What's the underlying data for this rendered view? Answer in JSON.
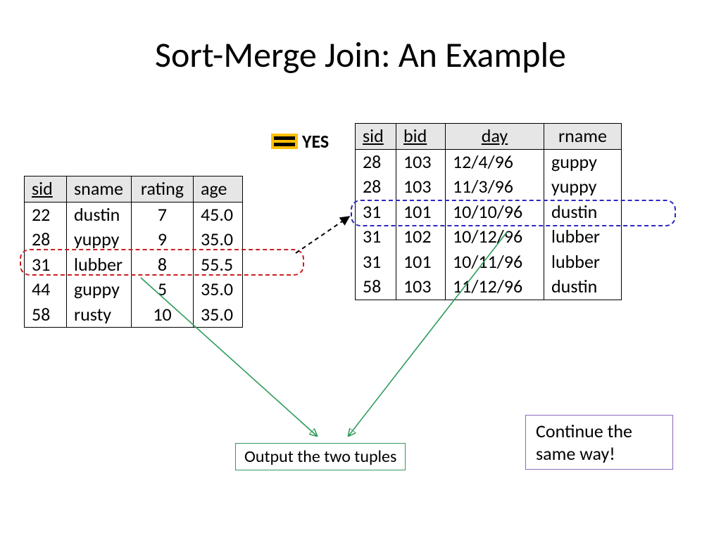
{
  "title": "Sort-Merge Join: An Example",
  "equals_label": "YES",
  "left": {
    "headers": {
      "sid": "sid",
      "sname": "sname",
      "rating": "rating",
      "age": "age"
    },
    "rows": [
      {
        "sid": "22",
        "sname": "dustin",
        "rating": "7",
        "age": "45.0"
      },
      {
        "sid": "28",
        "sname": "yuppy",
        "rating": "9",
        "age": "35.0"
      },
      {
        "sid": "31",
        "sname": "lubber",
        "rating": "8",
        "age": "55.5"
      },
      {
        "sid": "44",
        "sname": "guppy",
        "rating": "5",
        "age": "35.0"
      },
      {
        "sid": "58",
        "sname": "rusty",
        "rating": "10",
        "age": "35.0"
      }
    ],
    "highlight_index": 2
  },
  "right": {
    "headers": {
      "sid": "sid",
      "bid": "bid",
      "day": "day",
      "rname": "rname"
    },
    "rows": [
      {
        "sid": "28",
        "bid": "103",
        "day": "12/4/96",
        "rname": "guppy"
      },
      {
        "sid": "28",
        "bid": "103",
        "day": "11/3/96",
        "rname": "yuppy"
      },
      {
        "sid": "31",
        "bid": "101",
        "day": "10/10/96",
        "rname": "dustin"
      },
      {
        "sid": "31",
        "bid": "102",
        "day": "10/12/96",
        "rname": "lubber"
      },
      {
        "sid": "31",
        "bid": "101",
        "day": "10/11/96",
        "rname": "lubber"
      },
      {
        "sid": "58",
        "bid": "103",
        "day": "11/12/96",
        "rname": "dustin"
      }
    ],
    "highlight_index": 2
  },
  "callouts": {
    "output": "Output the two tuples",
    "continue": "Continue the same way!"
  }
}
